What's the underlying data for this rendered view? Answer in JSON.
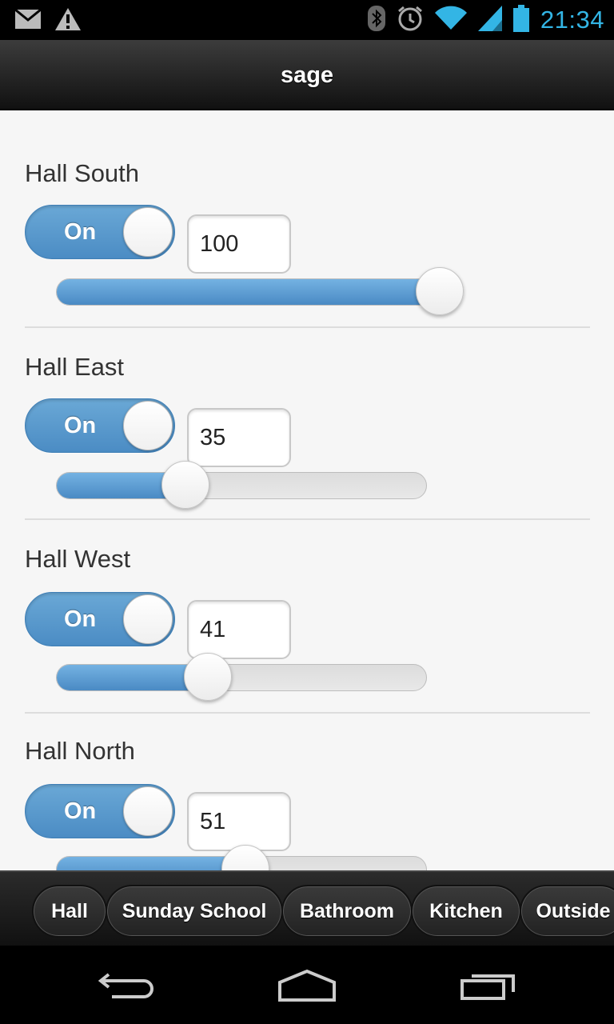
{
  "status": {
    "time": "21:34"
  },
  "header": {
    "title": "sage"
  },
  "lights": [
    {
      "name": "Hall South",
      "toggle_label": "On",
      "value": "100",
      "level": 100
    },
    {
      "name": "Hall East",
      "toggle_label": "On",
      "value": "35",
      "level": 35
    },
    {
      "name": "Hall West",
      "toggle_label": "On",
      "value": "41",
      "level": 41
    },
    {
      "name": "Hall North",
      "toggle_label": "On",
      "value": "51",
      "level": 51
    }
  ],
  "tabs": [
    "Hall",
    "Sunday School",
    "Bathroom",
    "Kitchen",
    "Outside"
  ],
  "colors": {
    "accent": "#4b8cc4",
    "status_clock": "#33b5e5"
  }
}
